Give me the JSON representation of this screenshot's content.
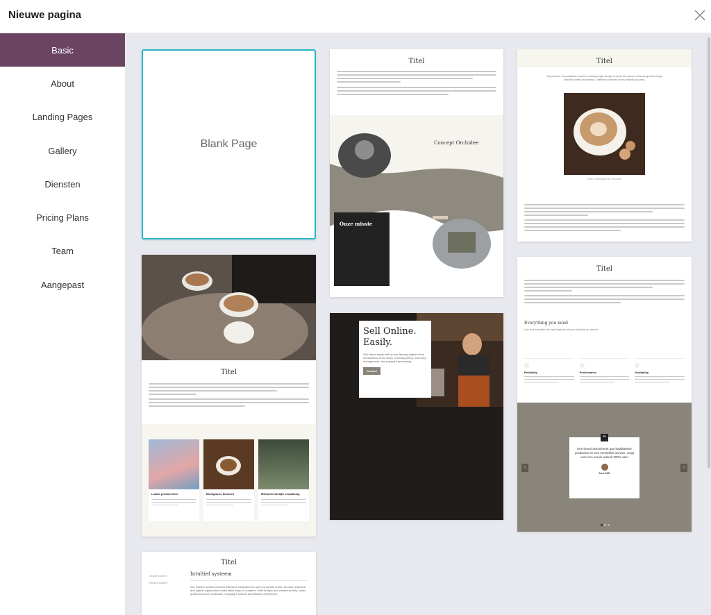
{
  "dialog": {
    "title": "Nieuwe pagina",
    "close_icon": "close-icon"
  },
  "sidebar": {
    "items": [
      {
        "label": "Basic",
        "active": true
      },
      {
        "label": "About"
      },
      {
        "label": "Landing Pages"
      },
      {
        "label": "Gallery"
      },
      {
        "label": "Diensten"
      },
      {
        "label": "Pricing Plans"
      },
      {
        "label": "Team"
      },
      {
        "label": "Aangepast"
      }
    ]
  },
  "templates": {
    "blank": {
      "label": "Blank Page"
    },
    "concept": {
      "title": "Titel",
      "heading": "Concept Orchidee",
      "mission_title": "Onze missie"
    },
    "coffee": {
      "title": "Titel",
      "tagline": "Experience unparalleled comfort, cutting-edge design and performance enhancing technology with this latest innovation, crafted to elevate every athletic journey.",
      "caption": "Write a description for the photo"
    },
    "products": {
      "title": "Titel",
      "items": [
        {
          "label": "Lokale producenten"
        },
        {
          "label": "Biologische bloemen"
        },
        {
          "label": "Milieuvriendelijke verpakking"
        }
      ]
    },
    "sell": {
      "heading_line1": "Sell Online.",
      "heading_line2": "Easily.",
      "body": "Sell online easily with a user-friendly platform that streamlines all the steps, including setup, inventory, management, and payment processing.",
      "button": "Contact"
    },
    "features": {
      "title": "Titel",
      "heading": "Everything you need",
      "subheading": "List and describe the key features of your solution or service.",
      "columns": [
        {
          "title": "Reliability"
        },
        {
          "title": "Performance"
        },
        {
          "title": "Scalability"
        }
      ],
      "testimonial": "Een breed assortiment aan kwalitatieve producten en een eersteklas service, zorgt voor een mooie winkel! 200% aan!",
      "author": "Jane SUE"
    },
    "system": {
      "title": "Titel",
      "side1": "Intuïtief systeem",
      "side2": "Efficiënt systeem",
      "heading": "Intuïtief systeem",
      "body": "Our intuitive system ensures effortless navigation for users of all skill levels. Its clean interface and logical organization make tasks easy to complete. With tooltips and contextual help, users quickly become productive, enjoying a smooth and efficient experience."
    }
  },
  "colors": {
    "accent": "#6b4462",
    "selected_border": "#29b6c9",
    "background": "#e8e9ee"
  }
}
